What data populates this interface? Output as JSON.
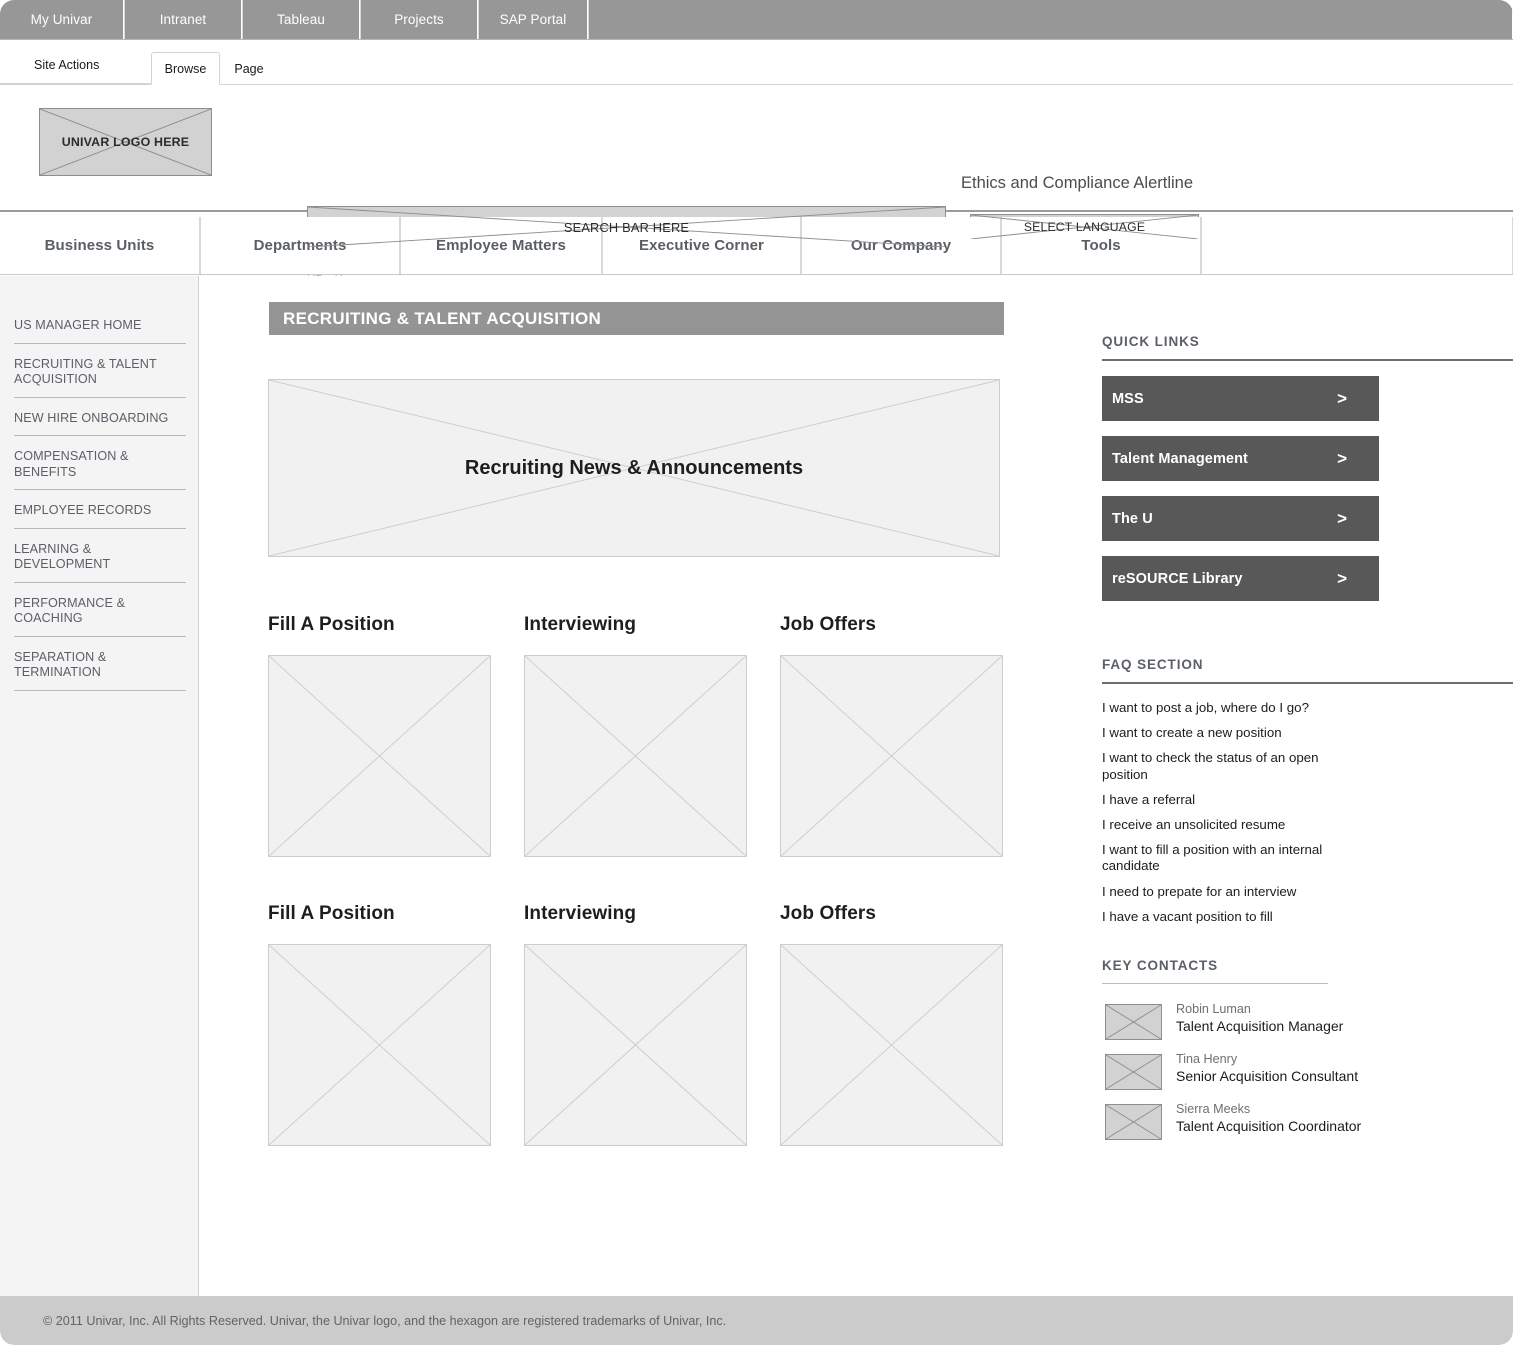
{
  "global_nav": {
    "items": [
      {
        "label": "My Univar"
      },
      {
        "label": "Intranet"
      },
      {
        "label": "Tableau"
      },
      {
        "label": "Projects"
      },
      {
        "label": "SAP Portal"
      }
    ]
  },
  "ribbon": {
    "site_actions": "Site Actions",
    "tabs": [
      {
        "label": "Browse",
        "active": true
      },
      {
        "label": "Page",
        "active": false
      }
    ]
  },
  "header": {
    "logo_placeholder": "UNIVAR LOGO HERE",
    "search_placeholder": "SEARCH BAR HERE",
    "alertline": "Ethics and Compliance Alertline",
    "language_button": "SELECT LANGUAGE",
    "breadcrumb": {
      "root": "HR",
      "separator": "▸",
      "current": "Home"
    }
  },
  "main_nav": {
    "items": [
      {
        "label": "Business Units"
      },
      {
        "label": "Departments"
      },
      {
        "label": "Employee Matters"
      },
      {
        "label": "Executive Corner"
      },
      {
        "label": "Our Company"
      },
      {
        "label": "Tools"
      }
    ]
  },
  "sidebar": {
    "items": [
      {
        "label": "US MANAGER HOME"
      },
      {
        "label": "RECRUITING & TALENT ACQUISITION"
      },
      {
        "label": "NEW HIRE ONBOARDING"
      },
      {
        "label": "COMPENSATION & BENEFITS"
      },
      {
        "label": "EMPLOYEE RECORDS"
      },
      {
        "label": "LEARNING & DEVELOPMENT"
      },
      {
        "label": "PERFORMANCE & COACHING"
      },
      {
        "label": "SEPARATION & TERMINATION"
      }
    ]
  },
  "content": {
    "page_title": "RECRUITING & TALENT ACQUISITION",
    "news_placeholder": "Recruiting News & Announcements",
    "cards": [
      [
        {
          "title": "Fill A Position"
        },
        {
          "title": "Interviewing"
        },
        {
          "title": "Job Offers"
        }
      ],
      [
        {
          "title": "Fill A Position"
        },
        {
          "title": "Interviewing"
        },
        {
          "title": "Job Offers"
        }
      ]
    ]
  },
  "right_rail": {
    "quick_links": {
      "heading": "QUICK LINKS",
      "arrow": ">",
      "items": [
        {
          "label": "MSS"
        },
        {
          "label": "Talent Management"
        },
        {
          "label": "The U"
        },
        {
          "label": "reSOURCE Library"
        }
      ]
    },
    "faq": {
      "heading": "FAQ SECTION",
      "items": [
        {
          "text": "I want to post a job, where do I go?"
        },
        {
          "text": "I want to create a new position"
        },
        {
          "text": "I want to check the status of an open position"
        },
        {
          "text": "I have a referral"
        },
        {
          "text": "I receive an unsolicited resume"
        },
        {
          "text": "I want to fill a position with an internal candidate"
        },
        {
          "text": "I need to prepate for an interview"
        },
        {
          "text": "I have a vacant position to fill"
        }
      ]
    },
    "key_contacts": {
      "heading": "KEY CONTACTS",
      "items": [
        {
          "name": "Robin Luman",
          "role": "Talent Acquisition Manager"
        },
        {
          "name": "Tina Henry",
          "role": "Senior Acquisition Consultant"
        },
        {
          "name": "Sierra Meeks",
          "role": "Talent Acquisition Coordinator"
        }
      ]
    }
  },
  "footer": {
    "copyright": "© 2011 Univar, Inc. All Rights Reserved. Univar, the Univar logo, and the hexagon are registered trademarks of Univar, Inc."
  },
  "colors": {
    "global_nav_bg": "#979797",
    "title_bar_bg": "#949494",
    "quick_link_bg": "#585858",
    "footer_bg": "#cbcbcb",
    "sidebar_bg": "#f4f4f4",
    "placeholder_fill": "#d2d2d2",
    "thumb_fill": "#f1f1f1"
  }
}
